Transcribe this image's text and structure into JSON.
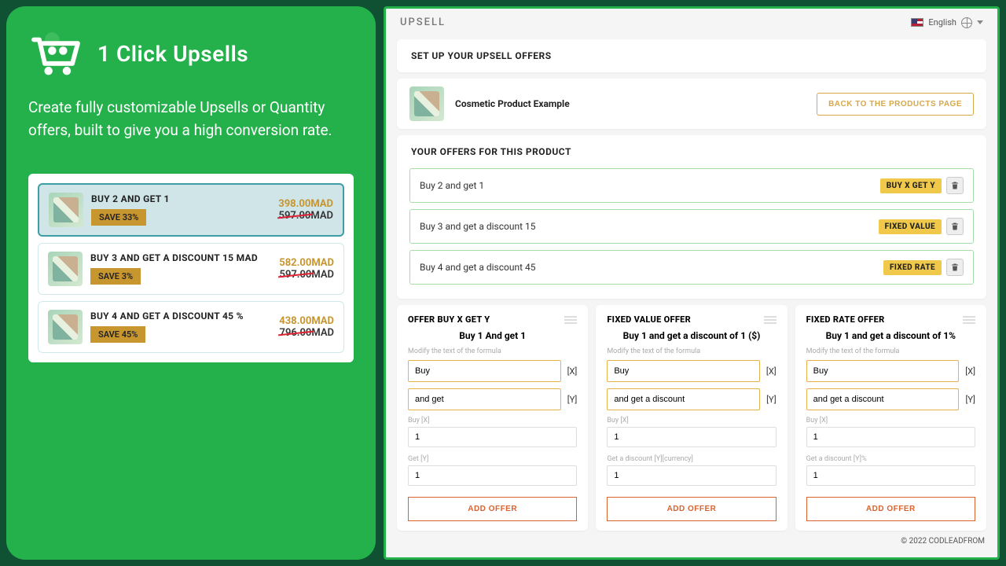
{
  "left": {
    "logo_text": "1 Click Upsells",
    "tagline": "Create fully customizable Upsells or Quantity offers,  built to give you a high conversion rate.",
    "preview_offers": [
      {
        "title": "BUY 2 AND GET 1",
        "save": "SAVE 33%",
        "new_price": "398.00MAD",
        "old_num": "597.00",
        "old_cur": "MAD",
        "selected": true
      },
      {
        "title": "BUY 3 AND GET A DISCOUNT 15 MAD",
        "save": "SAVE 3%",
        "new_price": "582.00MAD",
        "old_num": "597.00",
        "old_cur": "MAD",
        "selected": false
      },
      {
        "title": "BUY 4 AND GET A DISCOUNT 45 %",
        "save": "SAVE 45%",
        "new_price": "438.00MAD",
        "old_num": "796.00",
        "old_cur": "MAD",
        "selected": false
      }
    ]
  },
  "header": {
    "title": "UPSELL",
    "language": "English"
  },
  "setup_title": "SET UP YOUR UPSELL OFFERS",
  "product": {
    "name": "Cosmetic Product Example",
    "back_btn": "BACK TO THE PRODUCTS PAGE"
  },
  "offers_section_title": "YOUR OFFERS FOR THIS PRODUCT",
  "existing_offers": [
    {
      "label": "Buy 2 and get 1",
      "type": "BUY X GET Y"
    },
    {
      "label": "Buy 3 and get a discount 15",
      "type": "FIXED VALUE"
    },
    {
      "label": "Buy 4 and get a discount 45",
      "type": "FIXED RATE"
    }
  ],
  "builders": [
    {
      "title": "OFFER BUY X GET Y",
      "formula": "Buy 1 And get 1",
      "hint": "Modify the text of the formula",
      "field1": "Buy",
      "var1": "[X]",
      "field2": "and get",
      "var2": "[Y]",
      "num1_label": "Buy [X]",
      "num1": "1",
      "num2_label": "Get [Y]",
      "num2": "1",
      "add": "ADD OFFER"
    },
    {
      "title": "FIXED VALUE OFFER",
      "formula": "Buy 1 and get a discount of 1 ($)",
      "hint": "Modify the text of the formula",
      "field1": "Buy",
      "var1": "[X]",
      "field2": "and get a discount",
      "var2": "[Y]",
      "num1_label": "Buy [X]",
      "num1": "1",
      "num2_label": "Get a discount [Y][currency]",
      "num2": "1",
      "add": "ADD OFFER"
    },
    {
      "title": "FIXED RATE OFFER",
      "formula": "Buy 1 and get a discount of 1%",
      "hint": "Modify the text of the formula",
      "field1": "Buy",
      "var1": "[X]",
      "field2": "and get a discount",
      "var2": "[Y]",
      "num1_label": "Buy [X]",
      "num1": "1",
      "num2_label": "Get a discount [Y]%",
      "num2": "1",
      "add": "ADD OFFER"
    }
  ],
  "footer": "© 2022 CODLEADFROM"
}
